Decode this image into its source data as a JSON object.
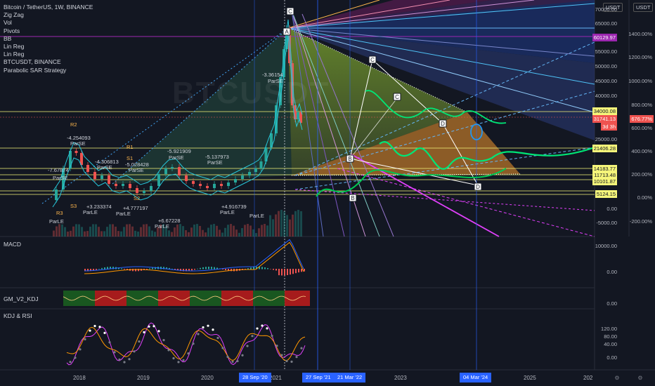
{
  "legend": {
    "symbol": "Bitcoin / TetherUS, 1W, BINANCE",
    "items": [
      "Zig Zag",
      "Vol",
      "Pivots",
      "BB",
      "Lin Reg",
      "Lin Reg",
      "BTCUSDT, BINANCE",
      "Parabolic SAR Strategy"
    ]
  },
  "watermark": "BTCUSDT",
  "panes": {
    "macd": "MACD",
    "kdj": "GM_V2_KDJ",
    "rsi": "KDJ & RSI"
  },
  "currency": [
    "USDT",
    "USDT"
  ],
  "price_axis": [
    "70000.00",
    "65000.00",
    "60000.00",
    "55000.00",
    "50000.00",
    "45000.00",
    "40000.00",
    "35000.00",
    "30000.00",
    "25000.00",
    "20000.00",
    "15000.00",
    "10000.00",
    "5000.00",
    "0.00",
    "-5000.00"
  ],
  "pct_axis": [
    "1400.00%",
    "1200.00%",
    "1000.00%",
    "800.00%",
    "600.00%",
    "400.00%",
    "200.00%",
    "0.00%",
    "-200.00%"
  ],
  "price_tags": [
    {
      "label": "60129.97",
      "color": "#9c27b0",
      "text": "#ffffff"
    },
    {
      "label": "34000.08",
      "color": "#f5f57a",
      "text": "#131722"
    },
    {
      "label": "31741.13",
      "color": "#ef5350",
      "text": "#ffffff"
    },
    {
      "label": "3d 3h",
      "color": "#ef5350",
      "text": "#ffffff"
    },
    {
      "label": "21406.28",
      "color": "#f5f57a",
      "text": "#131722"
    },
    {
      "label": "14183.77",
      "color": "#f5f57a",
      "text": "#131722"
    },
    {
      "label": "11713.48",
      "color": "#f5f57a",
      "text": "#131722"
    },
    {
      "label": "10101.87",
      "color": "#f5f57a",
      "text": "#131722"
    },
    {
      "label": "5124.15",
      "color": "#f5f57a",
      "text": "#131722"
    }
  ],
  "pct_tag": {
    "label": "676.77%",
    "color": "#ef5350"
  },
  "macd_axis": [
    "10000.00",
    "0.00"
  ],
  "kdj_axis": [
    "0.00"
  ],
  "rsi_axis": [
    "120.00",
    "80.00",
    "40.00",
    "0.00"
  ],
  "time_axis": [
    "2018",
    "2019",
    "2020",
    "2021",
    "2023",
    "2025",
    "202"
  ],
  "date_tags": [
    "28 Sep '20",
    "27 Sep '21",
    "21 Mar '22",
    "04 Mar '24"
  ],
  "pattern_labels": [
    "A",
    "B",
    "C",
    "D",
    "B",
    "C",
    "D",
    "C"
  ],
  "annotations": [
    "-4.254093",
    "ParSE",
    "-7.67874",
    "ParSE",
    "-4.306813",
    "ParSE",
    "-5.028428",
    "ParSE",
    "-5.921909",
    "ParSE",
    "-5.137973",
    "ParSE",
    "-3.36154",
    "ParSE",
    "ParLE",
    "+3.233374",
    "ParLE",
    "+4.777197",
    "ParLE",
    "+6.67228",
    "ParLE",
    "+4.916739",
    "ParLE",
    "ParLE",
    "R3",
    "R2",
    "R1",
    "S1",
    "S2",
    "S3"
  ],
  "colors": {
    "bg": "#131722",
    "up": "#26a69a",
    "down": "#ef5350",
    "accent": "#2962ff"
  }
}
